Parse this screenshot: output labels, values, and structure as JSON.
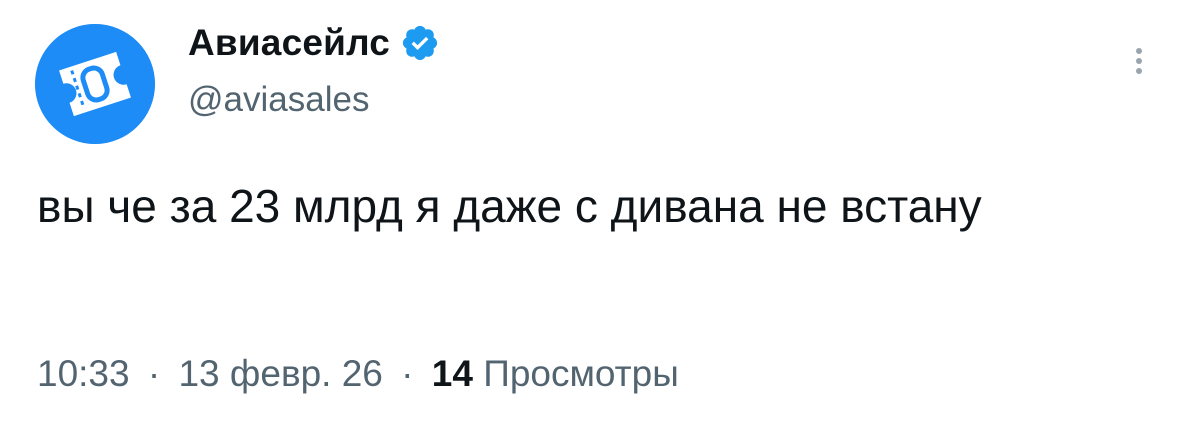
{
  "author": {
    "display_name": "Авиасейлс",
    "handle": "@aviasales",
    "verified": true,
    "avatar_color": "#1d8cf6",
    "verified_color": "#1d9bf0"
  },
  "tweet": {
    "text": "вы че за 23 млрд я даже с дивана не встану"
  },
  "meta": {
    "time": "10:33",
    "separator": "·",
    "date": "13 февр. 26",
    "views_count": "14",
    "views_label": "Просмотры"
  },
  "icons": {
    "more": "more-options-icon",
    "verified": "verified-badge-icon",
    "avatar": "ticket-logo-icon"
  }
}
